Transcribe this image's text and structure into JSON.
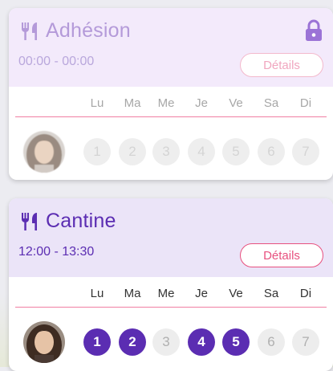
{
  "cards": [
    {
      "title": "Adhésion",
      "time": "00:00 - 00:00",
      "details_label": "Détails",
      "locked": true,
      "icon": "utensils-icon",
      "days": [
        {
          "label": "Lu",
          "number": "1",
          "selected": false
        },
        {
          "label": "Ma",
          "number": "2",
          "selected": false
        },
        {
          "label": "Me",
          "number": "3",
          "selected": false
        },
        {
          "label": "Je",
          "number": "4",
          "selected": false
        },
        {
          "label": "Ve",
          "number": "5",
          "selected": false
        },
        {
          "label": "Sa",
          "number": "6",
          "selected": false
        },
        {
          "label": "Di",
          "number": "7",
          "selected": false
        }
      ]
    },
    {
      "title": "Cantine",
      "time": "12:00 - 13:30",
      "details_label": "Détails",
      "locked": false,
      "icon": "utensils-icon",
      "days": [
        {
          "label": "Lu",
          "number": "1",
          "selected": true
        },
        {
          "label": "Ma",
          "number": "2",
          "selected": true
        },
        {
          "label": "Me",
          "number": "3",
          "selected": false
        },
        {
          "label": "Je",
          "number": "4",
          "selected": true
        },
        {
          "label": "Ve",
          "number": "5",
          "selected": true
        },
        {
          "label": "Sa",
          "number": "6",
          "selected": false
        },
        {
          "label": "Di",
          "number": "7",
          "selected": false
        }
      ]
    }
  ],
  "colors": {
    "accent": "#5b2db2",
    "accent_light": "#b49ad9",
    "details": "#e8517f",
    "header_bg": "#ebe4f8"
  }
}
